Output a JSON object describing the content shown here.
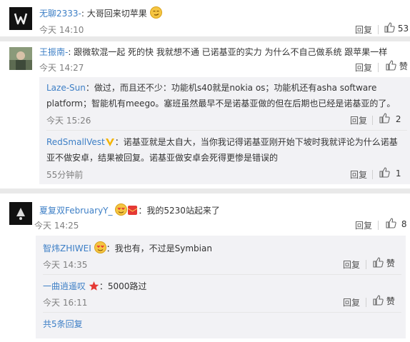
{
  "comments": [
    {
      "user": "无聊2333-",
      "colon": ":",
      "text": "大哥回来切苹果",
      "time": "今天 14:10",
      "reply_label": "回复",
      "like_count": "53"
    },
    {
      "user": "王振南-",
      "colon": ":",
      "text": "跟微软混一起 死的快 我就想不通 已诺基亚的实力 为什么不自己做系统 跟苹果一样",
      "time": "今天 14:27",
      "reply_label": "回复",
      "like_label": "赞",
      "replies": [
        {
          "user": "Laze-Sun",
          "colon": "：",
          "text_line1": "做过，而且还不少：功能机s40就是nokia os；功能机还有asha software",
          "text_line2": "platform；智能机有meego。塞班虽然最早不是诺基亚做的但在后期也已经是诺基亚的了。",
          "time": "今天 15:26",
          "reply_label": "回复",
          "like_count": "2"
        },
        {
          "user": "RedSmallVest",
          "colon": "：",
          "text_line1": "诺基亚就是太自大，当你我记得诺基亚刚开始下坡时我就评论为什么诺基",
          "text_line2": "亚不做安卓，结果被回复。诺基亚做安卓会死得更惨是错误的",
          "time": "55分钟前",
          "reply_label": "回复",
          "like_count": "1"
        }
      ]
    },
    {
      "user": "夏复双FebruaryY_",
      "colon": "：",
      "text": "我的5230站起来了",
      "time": "今天 14:25",
      "reply_label": "回复",
      "like_count": "8",
      "replies": [
        {
          "user": "智炜ZHIWEI",
          "colon": "：",
          "text": "我也有，不过是Symbian",
          "time": "今天 14:35",
          "reply_label": "回复",
          "like_label": "赞"
        },
        {
          "user": "一曲逍遥叹",
          "colon": "：",
          "text": "5000路过",
          "time": "今天 16:11",
          "reply_label": "回复",
          "like_label": "赞"
        }
      ],
      "more_replies": "共5条回复"
    }
  ],
  "icons": {
    "like": "thumbs-up-icon",
    "smile": "smirk-emoji-icon",
    "verified": "verified-v-icon",
    "star": "red-star-icon",
    "gift": "red-envelope-icon"
  },
  "colors": {
    "username": "#eb7350",
    "link": "#3d7fc6",
    "reply_bg": "#f2f2f5",
    "gap": "#e9e9e9"
  }
}
